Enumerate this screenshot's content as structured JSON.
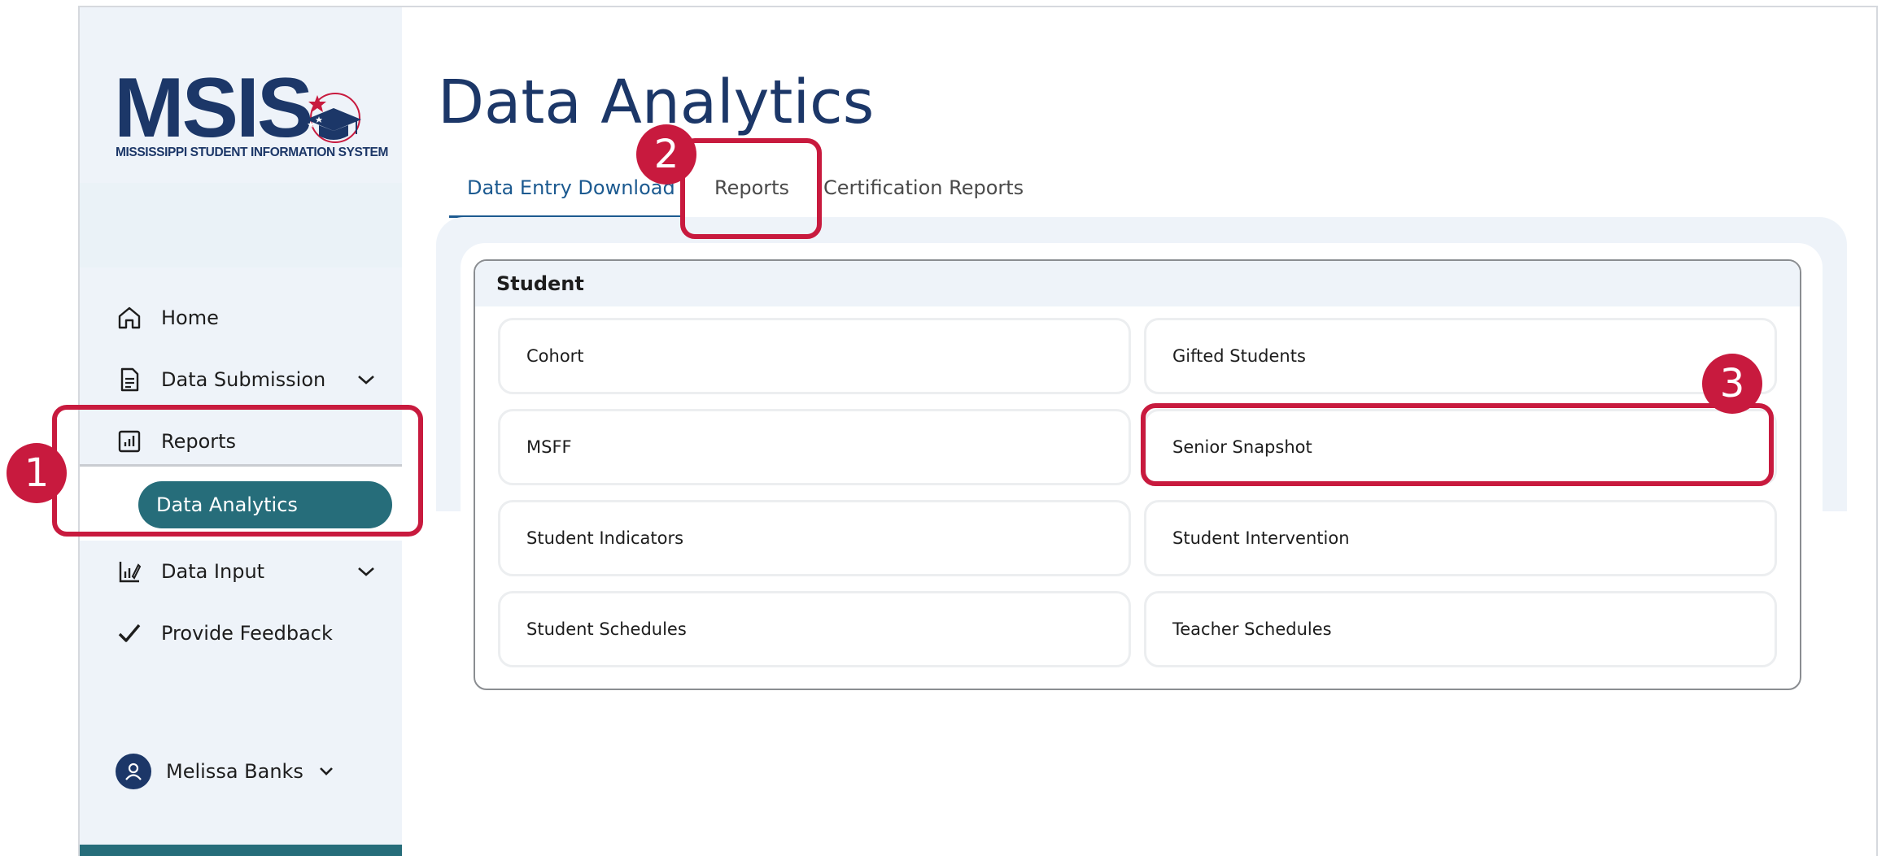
{
  "logo": {
    "wordmark": "MSIS",
    "subtitle": "MISSISSIPPI STUDENT INFORMATION SYSTEM",
    "icon": "graduation-cap-star-icon"
  },
  "sidebar": {
    "items": [
      {
        "label": "Home",
        "icon": "home-icon"
      },
      {
        "label": "Data Submission",
        "icon": "document-icon",
        "has_submenu": true
      },
      {
        "label": "Reports",
        "icon": "bar-chart-icon"
      },
      {
        "label": "Data Input",
        "icon": "chart-edit-icon",
        "has_submenu": true
      },
      {
        "label": "Provide Feedback",
        "icon": "checkmark-icon"
      }
    ],
    "active_subitem": "Data Analytics",
    "user": {
      "name": "Melissa Banks",
      "icon": "user-avatar-icon"
    }
  },
  "main": {
    "title": "Data Analytics",
    "tabs": [
      {
        "label": "Data Entry Download",
        "active": true
      },
      {
        "label": "Reports",
        "active": false
      },
      {
        "label": "Certification Reports",
        "active": false
      }
    ],
    "section": {
      "heading": "Student",
      "items": [
        "Cohort",
        "Gifted Students",
        "MSFF",
        "Senior Snapshot",
        "Student Indicators",
        "Student Intervention",
        "Student Schedules",
        "Teacher Schedules"
      ]
    }
  },
  "annotations": {
    "color": "#c81a3e",
    "steps": [
      "1",
      "2",
      "3"
    ]
  },
  "colors": {
    "brand_navy": "#1c3768",
    "accent_teal": "#266d7a",
    "tab_active": "#1c5a90",
    "sidebar_bg": "#eef3f9"
  }
}
